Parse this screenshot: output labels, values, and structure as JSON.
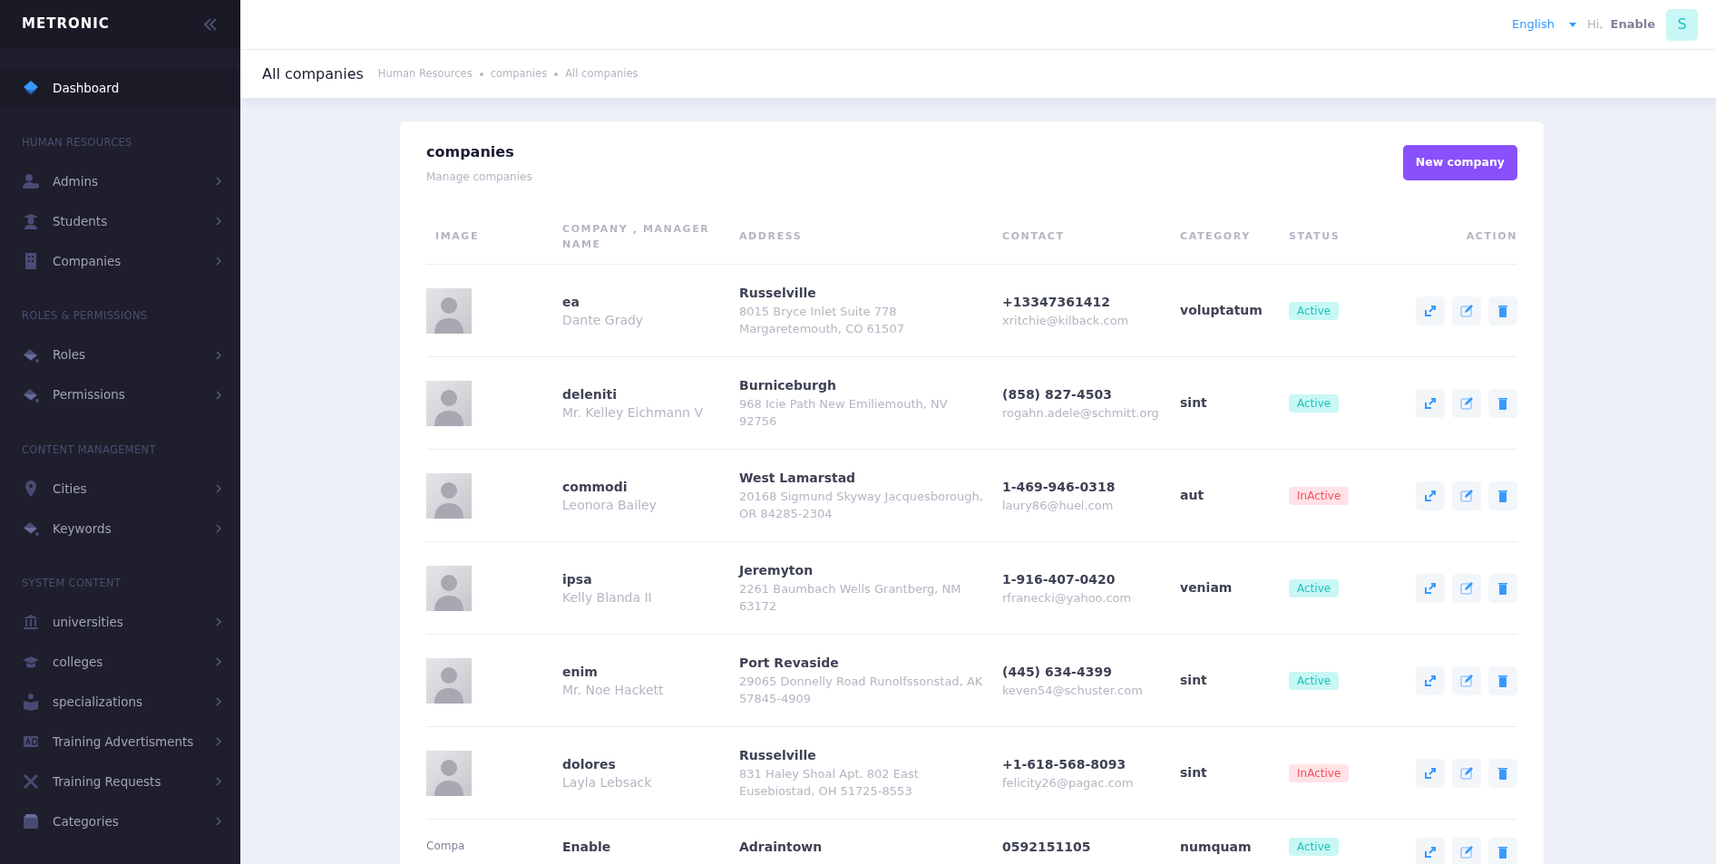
{
  "sidebar": {
    "logo": "METRONIC",
    "items": [
      {
        "kind": "link",
        "label": "Dashboard",
        "selected": true
      },
      {
        "kind": "section",
        "label": "HUMAN RESOURCES"
      },
      {
        "kind": "link",
        "label": "Admins",
        "selected": false
      },
      {
        "kind": "link",
        "label": "Students",
        "selected": false
      },
      {
        "kind": "link",
        "label": "Companies",
        "selected": false
      },
      {
        "kind": "section",
        "label": "ROLES & PERMISSIONS"
      },
      {
        "kind": "link",
        "label": "Roles",
        "selected": false
      },
      {
        "kind": "link",
        "label": "Permissions",
        "selected": false
      },
      {
        "kind": "section",
        "label": "CONTENT MANAGEMENT"
      },
      {
        "kind": "link",
        "label": "Cities",
        "selected": false
      },
      {
        "kind": "link",
        "label": "Keywords",
        "selected": false
      },
      {
        "kind": "section",
        "label": "SYSTEM CONTENT"
      },
      {
        "kind": "link",
        "label": "universities",
        "selected": false
      },
      {
        "kind": "link",
        "label": "colleges",
        "selected": false
      },
      {
        "kind": "link",
        "label": "specializations",
        "selected": false
      },
      {
        "kind": "link",
        "label": "Training Advertisments",
        "selected": false
      },
      {
        "kind": "link",
        "label": "Training Requests",
        "selected": false
      },
      {
        "kind": "link",
        "label": "Categories",
        "selected": false
      }
    ]
  },
  "topbar": {
    "language": "English",
    "greeting": "Hi,",
    "user": "Enable",
    "avatar": "S"
  },
  "subheader": {
    "title": "All companies",
    "breadcrumbs": [
      "Human Resources",
      "companies",
      "All companies"
    ]
  },
  "card": {
    "title": "companies",
    "subtitle": "Manage companies",
    "button": "New company",
    "columns": [
      "IMAGE",
      "COMPANY , MANAGER NAME",
      "ADDRESS",
      "CONTACT",
      "CATEGORY",
      "STATUS",
      "ACTION"
    ],
    "rows": [
      {
        "image": {
          "kind": "placeholder"
        },
        "company": "ea",
        "manager": "Dante Grady",
        "city": "Russelville",
        "address": "8015 Bryce Inlet Suite 778 Margaretemouth, CO 61507",
        "phone": "+13347361412",
        "email": "xritchie@kilback.com",
        "category": "voluptatum",
        "status": "Active",
        "active": true
      },
      {
        "image": {
          "kind": "placeholder"
        },
        "company": "deleniti",
        "manager": "Mr. Kelley Eichmann V",
        "city": "Burniceburgh",
        "address": "968 Icie Path New Emiliemouth, NV 92756",
        "phone": "(858) 827-4503",
        "email": "rogahn.adele@schmitt.org",
        "category": "sint",
        "status": "Active",
        "active": true
      },
      {
        "image": {
          "kind": "placeholder"
        },
        "company": "commodi",
        "manager": "Leonora Bailey",
        "city": "West Lamarstad",
        "address": "20168 Sigmund Skyway Jacquesborough, OR 84285-2304",
        "phone": "1-469-946-0318",
        "email": "laury86@huel.com",
        "category": "aut",
        "status": "InActive",
        "active": false
      },
      {
        "image": {
          "kind": "placeholder"
        },
        "company": "ipsa",
        "manager": "Kelly Blanda II",
        "city": "Jeremyton",
        "address": "2261 Baumbach Wells Grantberg, NM 63172",
        "phone": "1-916-407-0420",
        "email": "rfranecki@yahoo.com",
        "category": "veniam",
        "status": "Active",
        "active": true
      },
      {
        "image": {
          "kind": "placeholder"
        },
        "company": "enim",
        "manager": "Mr. Noe Hackett",
        "city": "Port Revaside",
        "address": "29065 Donnelly Road Runolfssonstad, AK 57845-4909",
        "phone": "(445) 634-4399",
        "email": "keven54@schuster.com",
        "category": "sint",
        "status": "Active",
        "active": true
      },
      {
        "image": {
          "kind": "placeholder"
        },
        "company": "dolores",
        "manager": "Layla Lebsack",
        "city": "Russelville",
        "address": "831 Haley Shoal Apt. 802 East Eusebiostad, OH 51725-8553",
        "phone": "+1-618-568-8093",
        "email": "felicity26@pagac.com",
        "category": "sint",
        "status": "InActive",
        "active": false
      },
      {
        "image": {
          "kind": "broken",
          "alt": "Compa"
        },
        "company": "Enable",
        "city": "Adraintown",
        "phone": "0592151105",
        "category": "numquam",
        "status": "Active",
        "active": true
      }
    ]
  }
}
